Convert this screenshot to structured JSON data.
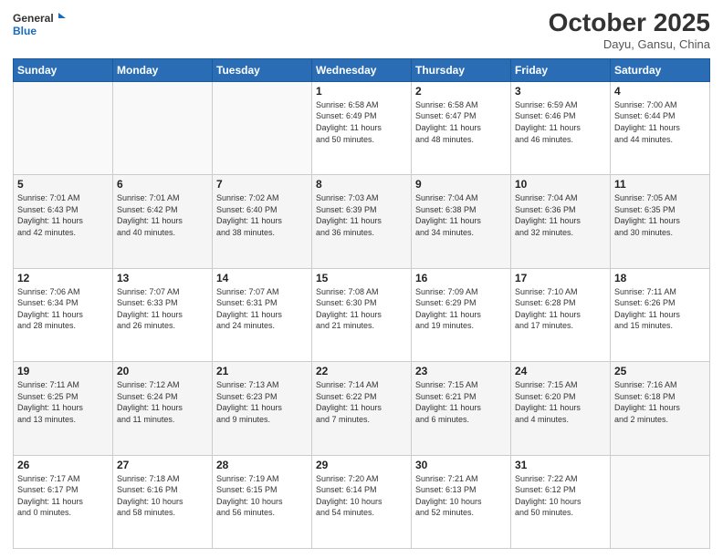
{
  "header": {
    "logo_line1": "General",
    "logo_line2": "Blue",
    "month": "October 2025",
    "location": "Dayu, Gansu, China"
  },
  "weekdays": [
    "Sunday",
    "Monday",
    "Tuesday",
    "Wednesday",
    "Thursday",
    "Friday",
    "Saturday"
  ],
  "weeks": [
    [
      {
        "day": "",
        "info": ""
      },
      {
        "day": "",
        "info": ""
      },
      {
        "day": "",
        "info": ""
      },
      {
        "day": "1",
        "info": "Sunrise: 6:58 AM\nSunset: 6:49 PM\nDaylight: 11 hours\nand 50 minutes."
      },
      {
        "day": "2",
        "info": "Sunrise: 6:58 AM\nSunset: 6:47 PM\nDaylight: 11 hours\nand 48 minutes."
      },
      {
        "day": "3",
        "info": "Sunrise: 6:59 AM\nSunset: 6:46 PM\nDaylight: 11 hours\nand 46 minutes."
      },
      {
        "day": "4",
        "info": "Sunrise: 7:00 AM\nSunset: 6:44 PM\nDaylight: 11 hours\nand 44 minutes."
      }
    ],
    [
      {
        "day": "5",
        "info": "Sunrise: 7:01 AM\nSunset: 6:43 PM\nDaylight: 11 hours\nand 42 minutes."
      },
      {
        "day": "6",
        "info": "Sunrise: 7:01 AM\nSunset: 6:42 PM\nDaylight: 11 hours\nand 40 minutes."
      },
      {
        "day": "7",
        "info": "Sunrise: 7:02 AM\nSunset: 6:40 PM\nDaylight: 11 hours\nand 38 minutes."
      },
      {
        "day": "8",
        "info": "Sunrise: 7:03 AM\nSunset: 6:39 PM\nDaylight: 11 hours\nand 36 minutes."
      },
      {
        "day": "9",
        "info": "Sunrise: 7:04 AM\nSunset: 6:38 PM\nDaylight: 11 hours\nand 34 minutes."
      },
      {
        "day": "10",
        "info": "Sunrise: 7:04 AM\nSunset: 6:36 PM\nDaylight: 11 hours\nand 32 minutes."
      },
      {
        "day": "11",
        "info": "Sunrise: 7:05 AM\nSunset: 6:35 PM\nDaylight: 11 hours\nand 30 minutes."
      }
    ],
    [
      {
        "day": "12",
        "info": "Sunrise: 7:06 AM\nSunset: 6:34 PM\nDaylight: 11 hours\nand 28 minutes."
      },
      {
        "day": "13",
        "info": "Sunrise: 7:07 AM\nSunset: 6:33 PM\nDaylight: 11 hours\nand 26 minutes."
      },
      {
        "day": "14",
        "info": "Sunrise: 7:07 AM\nSunset: 6:31 PM\nDaylight: 11 hours\nand 24 minutes."
      },
      {
        "day": "15",
        "info": "Sunrise: 7:08 AM\nSunset: 6:30 PM\nDaylight: 11 hours\nand 21 minutes."
      },
      {
        "day": "16",
        "info": "Sunrise: 7:09 AM\nSunset: 6:29 PM\nDaylight: 11 hours\nand 19 minutes."
      },
      {
        "day": "17",
        "info": "Sunrise: 7:10 AM\nSunset: 6:28 PM\nDaylight: 11 hours\nand 17 minutes."
      },
      {
        "day": "18",
        "info": "Sunrise: 7:11 AM\nSunset: 6:26 PM\nDaylight: 11 hours\nand 15 minutes."
      }
    ],
    [
      {
        "day": "19",
        "info": "Sunrise: 7:11 AM\nSunset: 6:25 PM\nDaylight: 11 hours\nand 13 minutes."
      },
      {
        "day": "20",
        "info": "Sunrise: 7:12 AM\nSunset: 6:24 PM\nDaylight: 11 hours\nand 11 minutes."
      },
      {
        "day": "21",
        "info": "Sunrise: 7:13 AM\nSunset: 6:23 PM\nDaylight: 11 hours\nand 9 minutes."
      },
      {
        "day": "22",
        "info": "Sunrise: 7:14 AM\nSunset: 6:22 PM\nDaylight: 11 hours\nand 7 minutes."
      },
      {
        "day": "23",
        "info": "Sunrise: 7:15 AM\nSunset: 6:21 PM\nDaylight: 11 hours\nand 6 minutes."
      },
      {
        "day": "24",
        "info": "Sunrise: 7:15 AM\nSunset: 6:20 PM\nDaylight: 11 hours\nand 4 minutes."
      },
      {
        "day": "25",
        "info": "Sunrise: 7:16 AM\nSunset: 6:18 PM\nDaylight: 11 hours\nand 2 minutes."
      }
    ],
    [
      {
        "day": "26",
        "info": "Sunrise: 7:17 AM\nSunset: 6:17 PM\nDaylight: 11 hours\nand 0 minutes."
      },
      {
        "day": "27",
        "info": "Sunrise: 7:18 AM\nSunset: 6:16 PM\nDaylight: 10 hours\nand 58 minutes."
      },
      {
        "day": "28",
        "info": "Sunrise: 7:19 AM\nSunset: 6:15 PM\nDaylight: 10 hours\nand 56 minutes."
      },
      {
        "day": "29",
        "info": "Sunrise: 7:20 AM\nSunset: 6:14 PM\nDaylight: 10 hours\nand 54 minutes."
      },
      {
        "day": "30",
        "info": "Sunrise: 7:21 AM\nSunset: 6:13 PM\nDaylight: 10 hours\nand 52 minutes."
      },
      {
        "day": "31",
        "info": "Sunrise: 7:22 AM\nSunset: 6:12 PM\nDaylight: 10 hours\nand 50 minutes."
      },
      {
        "day": "",
        "info": ""
      }
    ]
  ]
}
